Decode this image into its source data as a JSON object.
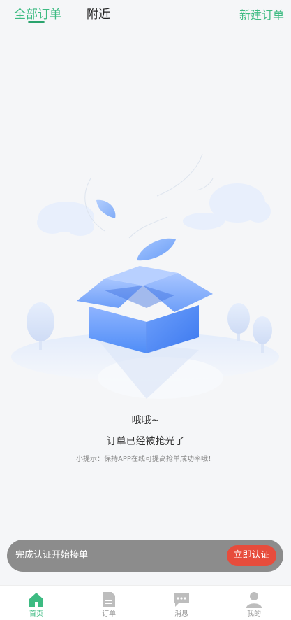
{
  "header": {
    "tabs": [
      {
        "label": "全部订单",
        "active": true
      },
      {
        "label": "附近",
        "active": false
      }
    ],
    "action_label": "新建订单"
  },
  "empty_state": {
    "title": "哦哦~",
    "subtitle": "订单已经被抢光了",
    "tip": "小提示：保持APP在线可提高抢单成功率哦！"
  },
  "certification": {
    "text": "完成认证开始接单",
    "button_label": "立即认证"
  },
  "bottom_nav": {
    "items": [
      {
        "label": "首页",
        "icon": "home-icon",
        "active": true
      },
      {
        "label": "订单",
        "icon": "document-icon",
        "active": false
      },
      {
        "label": "消息",
        "icon": "message-icon",
        "active": false
      },
      {
        "label": "我的",
        "icon": "profile-icon",
        "active": false
      }
    ]
  },
  "colors": {
    "accent": "#3dbb82",
    "cert_button": "#e74c3c",
    "banner": "#8c8c8c"
  }
}
